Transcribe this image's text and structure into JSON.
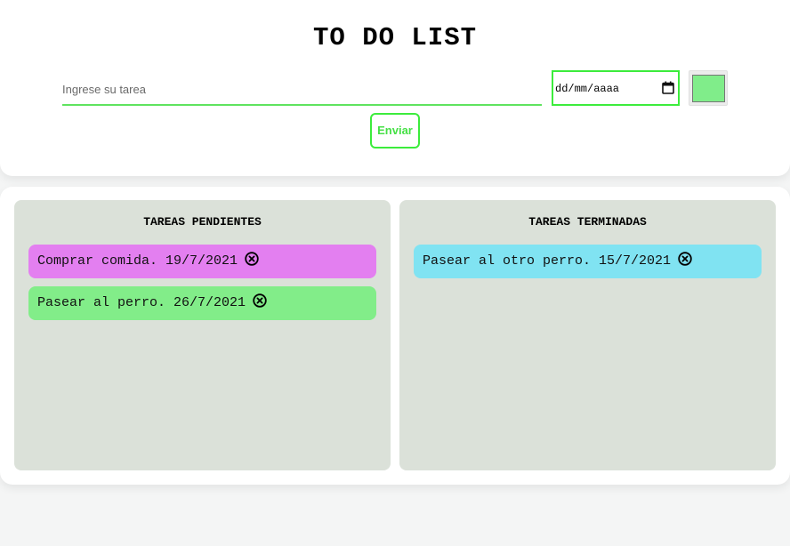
{
  "header": {
    "title": "TO DO LIST",
    "task_placeholder": "Ingrese su tarea",
    "task_value": "",
    "date_placeholder": "dd/mm/aaaa",
    "selected_color": "#80ed8a",
    "send_label": "Enviar",
    "accent_color": "#3cec3c"
  },
  "pending": {
    "title": "TAREAS PENDIENTES",
    "tasks": [
      {
        "text": "Comprar comida. 19/7/2021",
        "color": "#e37ff0",
        "icon": "close-circle-icon"
      },
      {
        "text": "Pasear al perro. 26/7/2021",
        "color": "#82ed89",
        "icon": "close-circle-icon"
      }
    ]
  },
  "done": {
    "title": "TAREAS TERMINADAS",
    "tasks": [
      {
        "text": "Pasear al otro perro. 15/7/2021",
        "color": "#80e3f2",
        "icon": "close-circle-icon"
      }
    ]
  }
}
